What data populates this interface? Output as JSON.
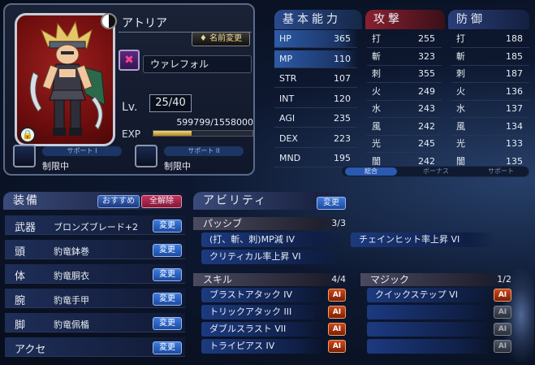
{
  "character": {
    "name": "アトリア",
    "rename_label": "名前変更",
    "job_name": "ウァレフォル",
    "level_label": "Lv.",
    "level": "25/40",
    "exp_label": "EXP",
    "exp_value": "599799/1558000",
    "exp_fraction": 0.385
  },
  "supports": [
    {
      "tag": "サポート I",
      "status": "制限中"
    },
    {
      "tag": "サポート II",
      "status": "制限中"
    }
  ],
  "stats": {
    "base_title": "基本能力",
    "base": [
      {
        "label": "HP",
        "value": "365"
      },
      {
        "label": "MP",
        "value": "110"
      },
      {
        "label": "STR",
        "value": "107"
      },
      {
        "label": "INT",
        "value": "120"
      },
      {
        "label": "AGI",
        "value": "235"
      },
      {
        "label": "DEX",
        "value": "223"
      },
      {
        "label": "MND",
        "value": "195"
      }
    ],
    "attack_title": "攻撃",
    "attack": [
      {
        "label": "打",
        "value": "255"
      },
      {
        "label": "斬",
        "value": "323"
      },
      {
        "label": "刺",
        "value": "355"
      },
      {
        "label": "火",
        "value": "249"
      },
      {
        "label": "水",
        "value": "243"
      },
      {
        "label": "風",
        "value": "242"
      },
      {
        "label": "光",
        "value": "245"
      },
      {
        "label": "闇",
        "value": "242"
      }
    ],
    "defense_title": "防御",
    "defense": [
      {
        "label": "打",
        "value": "188"
      },
      {
        "label": "斬",
        "value": "185"
      },
      {
        "label": "刺",
        "value": "187"
      },
      {
        "label": "火",
        "value": "136"
      },
      {
        "label": "水",
        "value": "137"
      },
      {
        "label": "風",
        "value": "134"
      },
      {
        "label": "光",
        "value": "133"
      },
      {
        "label": "闇",
        "value": "135"
      }
    ]
  },
  "tabs": [
    "総合",
    "ボーナス",
    "サポート"
  ],
  "equipment": {
    "title": "装備",
    "recommend_label": "おすすめ",
    "clear_label": "全解除",
    "change_label": "変更",
    "slots": [
      {
        "slot": "武器",
        "item": "ブロンズブレード+2"
      },
      {
        "slot": "頭",
        "item": "豹竜鉢巻"
      },
      {
        "slot": "体",
        "item": "豹竜胴衣"
      },
      {
        "slot": "腕",
        "item": "豹竜手甲"
      },
      {
        "slot": "脚",
        "item": "豹竜佩楯"
      },
      {
        "slot": "アクセ",
        "item": ""
      }
    ]
  },
  "abilities": {
    "title": "アビリティ",
    "change_label": "変更",
    "passive": {
      "title": "パッシブ",
      "count": "3/3",
      "items": [
        "(打、斬、刺)MP減 IV",
        "チェインヒット率上昇 VI",
        "クリティカル率上昇 VI"
      ]
    },
    "skill": {
      "title": "スキル",
      "count": "4/4",
      "ai_label": "AI",
      "items": [
        "ブラストアタック IV",
        "トリックアタック III",
        "ダブルスラスト VII",
        "トライピアス IV"
      ]
    },
    "magic": {
      "title": "マジック",
      "count": "1/2",
      "ai_label": "AI",
      "items": [
        "クイックステップ VI",
        "",
        "",
        ""
      ]
    }
  }
}
